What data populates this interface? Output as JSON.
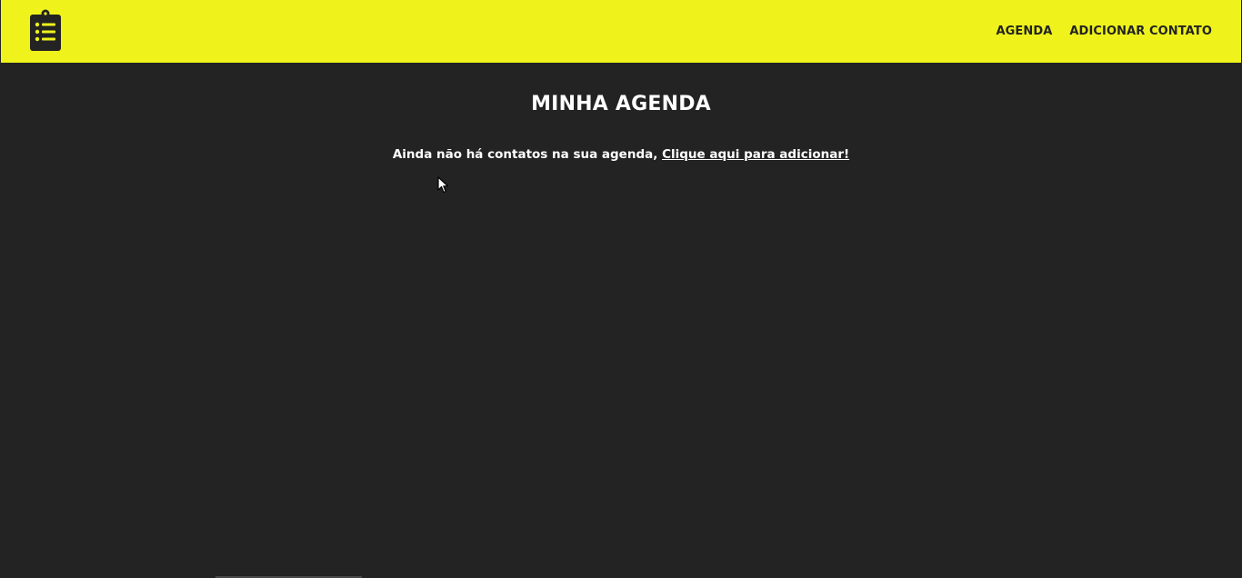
{
  "header": {
    "logo_icon": "clipboard-list-icon",
    "nav": [
      {
        "label": "AGENDA"
      },
      {
        "label": "ADICIONAR CONTATO"
      }
    ]
  },
  "main": {
    "title": "MINHA AGENDA",
    "empty_text": "Ainda não há contatos na sua agenda, ",
    "add_link": "Clique aqui para adicionar!"
  },
  "colors": {
    "header_background": "#eff31b",
    "page_background": "#232323",
    "text": "#ffffff"
  }
}
